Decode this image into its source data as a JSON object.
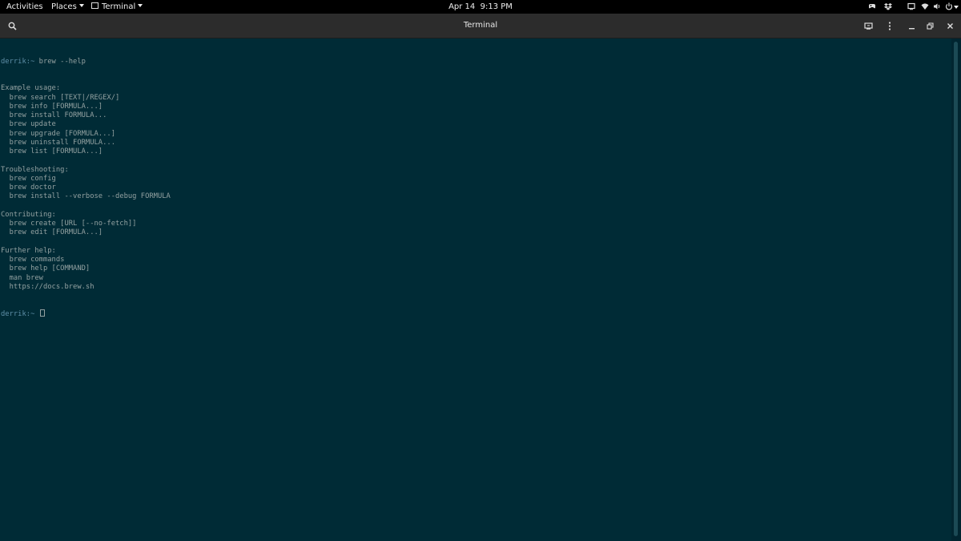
{
  "topbar": {
    "activities": "Activities",
    "places": "Places",
    "app_menu": "Terminal",
    "date": "Apr 14",
    "time": "9:13 PM",
    "tray_icons": [
      "controller-icon",
      "dropbox-icon",
      "screen-icon",
      "wifi-icon",
      "volume-icon",
      "power-icon"
    ]
  },
  "window": {
    "title": "Terminal"
  },
  "terminal": {
    "command_prompt": "derrik:~",
    "command": " brew --help",
    "output": [
      "Example usage:",
      "  brew search [TEXT|/REGEX/]",
      "  brew info [FORMULA...]",
      "  brew install FORMULA...",
      "  brew update",
      "  brew upgrade [FORMULA...]",
      "  brew uninstall FORMULA...",
      "  brew list [FORMULA...]",
      "",
      "Troubleshooting:",
      "  brew config",
      "  brew doctor",
      "  brew install --verbose --debug FORMULA",
      "",
      "Contributing:",
      "  brew create [URL [--no-fetch]]",
      "  brew edit [FORMULA...]",
      "",
      "Further help:",
      "  brew commands",
      "  brew help [COMMAND]",
      "  man brew",
      "  https://docs.brew.sh"
    ],
    "final_prompt": "derrik:~ "
  },
  "colors": {
    "terminal_bg": "#002b36",
    "terminal_fg": "#93a1a1",
    "prompt": "#5f8fa8",
    "topbar_bg": "#000000",
    "headerbar_bg": "#2c2c2c"
  }
}
